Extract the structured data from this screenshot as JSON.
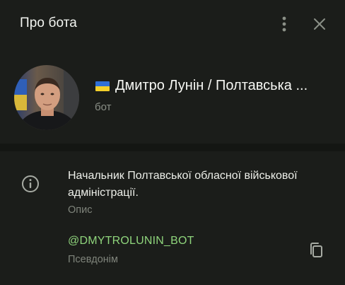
{
  "header": {
    "title": "Про бота",
    "menu_icon": "more-vertical-icon",
    "close_icon": "close-icon"
  },
  "profile": {
    "name": "Дмитро Лунін / Полтавська ...",
    "flag_icon": "ukraine-flag-icon",
    "status": "бот"
  },
  "info": {
    "icon": "info-icon",
    "description": "Начальник Полтавської обласної військової адміністрації.",
    "description_label": "Опис",
    "username": "@DMYTROLUNIN_BOT",
    "username_label": "Псевдонім",
    "copy_icon": "copy-icon"
  },
  "colors": {
    "background": "#1b1d1a",
    "username_accent": "#8fd57c",
    "muted_text": "#7f847b"
  }
}
